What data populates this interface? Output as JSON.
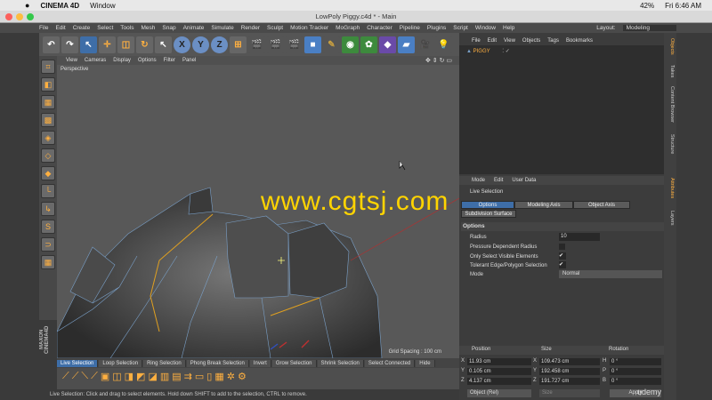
{
  "mac_menu": {
    "apple": "",
    "app": "CINEMA 4D",
    "window": "Window",
    "battery": "42%",
    "clock": "Fri 6:46 AM"
  },
  "title_bar": {
    "title": "LowPoly Piggy.c4d * - Main"
  },
  "app_menu": [
    "File",
    "Edit",
    "Create",
    "Select",
    "Tools",
    "Mesh",
    "Snap",
    "Animate",
    "Simulate",
    "Render",
    "Sculpt",
    "Motion Tracker",
    "MoGraph",
    "Character",
    "Pipeline",
    "Plugins",
    "Script",
    "Window",
    "Help"
  ],
  "layout": {
    "label": "Layout:",
    "value": "Modeling"
  },
  "toolbar": {
    "x_label": "X",
    "y_label": "Y",
    "z_label": "Z"
  },
  "viewport": {
    "menu": [
      "View",
      "Cameras",
      "Display",
      "Options",
      "Filter",
      "Panel"
    ],
    "name": "Perspective",
    "grid_spacing": "Grid Spacing : 100 cm",
    "watermark": "www.cgtsj.com"
  },
  "selection_tabs": [
    "Live Selection",
    "Loop Selection",
    "Ring Selection",
    "Phong Break Selection",
    "Invert",
    "Grow Selection",
    "Shrink Selection",
    "Select Connected",
    "Hide"
  ],
  "status_bar": "Live Selection: Click and drag to select elements. Hold down SHIFT to add to the selection, CTRL to remove.",
  "maxon": "MAXON CINEMA4D",
  "objects": {
    "menu": [
      "File",
      "Edit",
      "View",
      "Objects",
      "Tags",
      "Bookmarks"
    ],
    "item": "PIGGY"
  },
  "attributes": {
    "menu": [
      "Mode",
      "Edit",
      "User Data"
    ],
    "live_selection": "Live Selection",
    "axis_buttons": [
      "Options",
      "Modeling Axis",
      "Object Axis"
    ],
    "subdivision": "Subdivision Surface",
    "options_title": "Options",
    "radius_label": "Radius",
    "radius_value": "10",
    "pressure_label": "Pressure Dependent Radius",
    "visible_label": "Only Select Visible Elements",
    "visible_check": "✔",
    "tolerant_label": "Tolerant Edge/Polygon Selection",
    "tolerant_check": "✔",
    "mode_label": "Mode",
    "mode_value": "Normal"
  },
  "vtabs": [
    "Objects",
    "Takes",
    "Content Browser",
    "Structure",
    "Attributes",
    "Layers"
  ],
  "coords": {
    "position": "Position",
    "size": "Size",
    "rotation": "Rotation",
    "rows": [
      {
        "axis": "X",
        "pos": "11.93 cm",
        "size": "109.473 cm",
        "rot_axis": "H",
        "rot": "0 °"
      },
      {
        "axis": "Y",
        "pos": "0.105 cm",
        "size": "192.458 cm",
        "rot_axis": "P",
        "rot": "0 °"
      },
      {
        "axis": "Z",
        "pos": "4.137 cm",
        "size": "191.727 cm",
        "rot_axis": "B",
        "rot": "0 °"
      }
    ],
    "mode": "Object (Rel)",
    "size_mode": "Size",
    "apply": "Apply"
  },
  "udemy": "udemy"
}
